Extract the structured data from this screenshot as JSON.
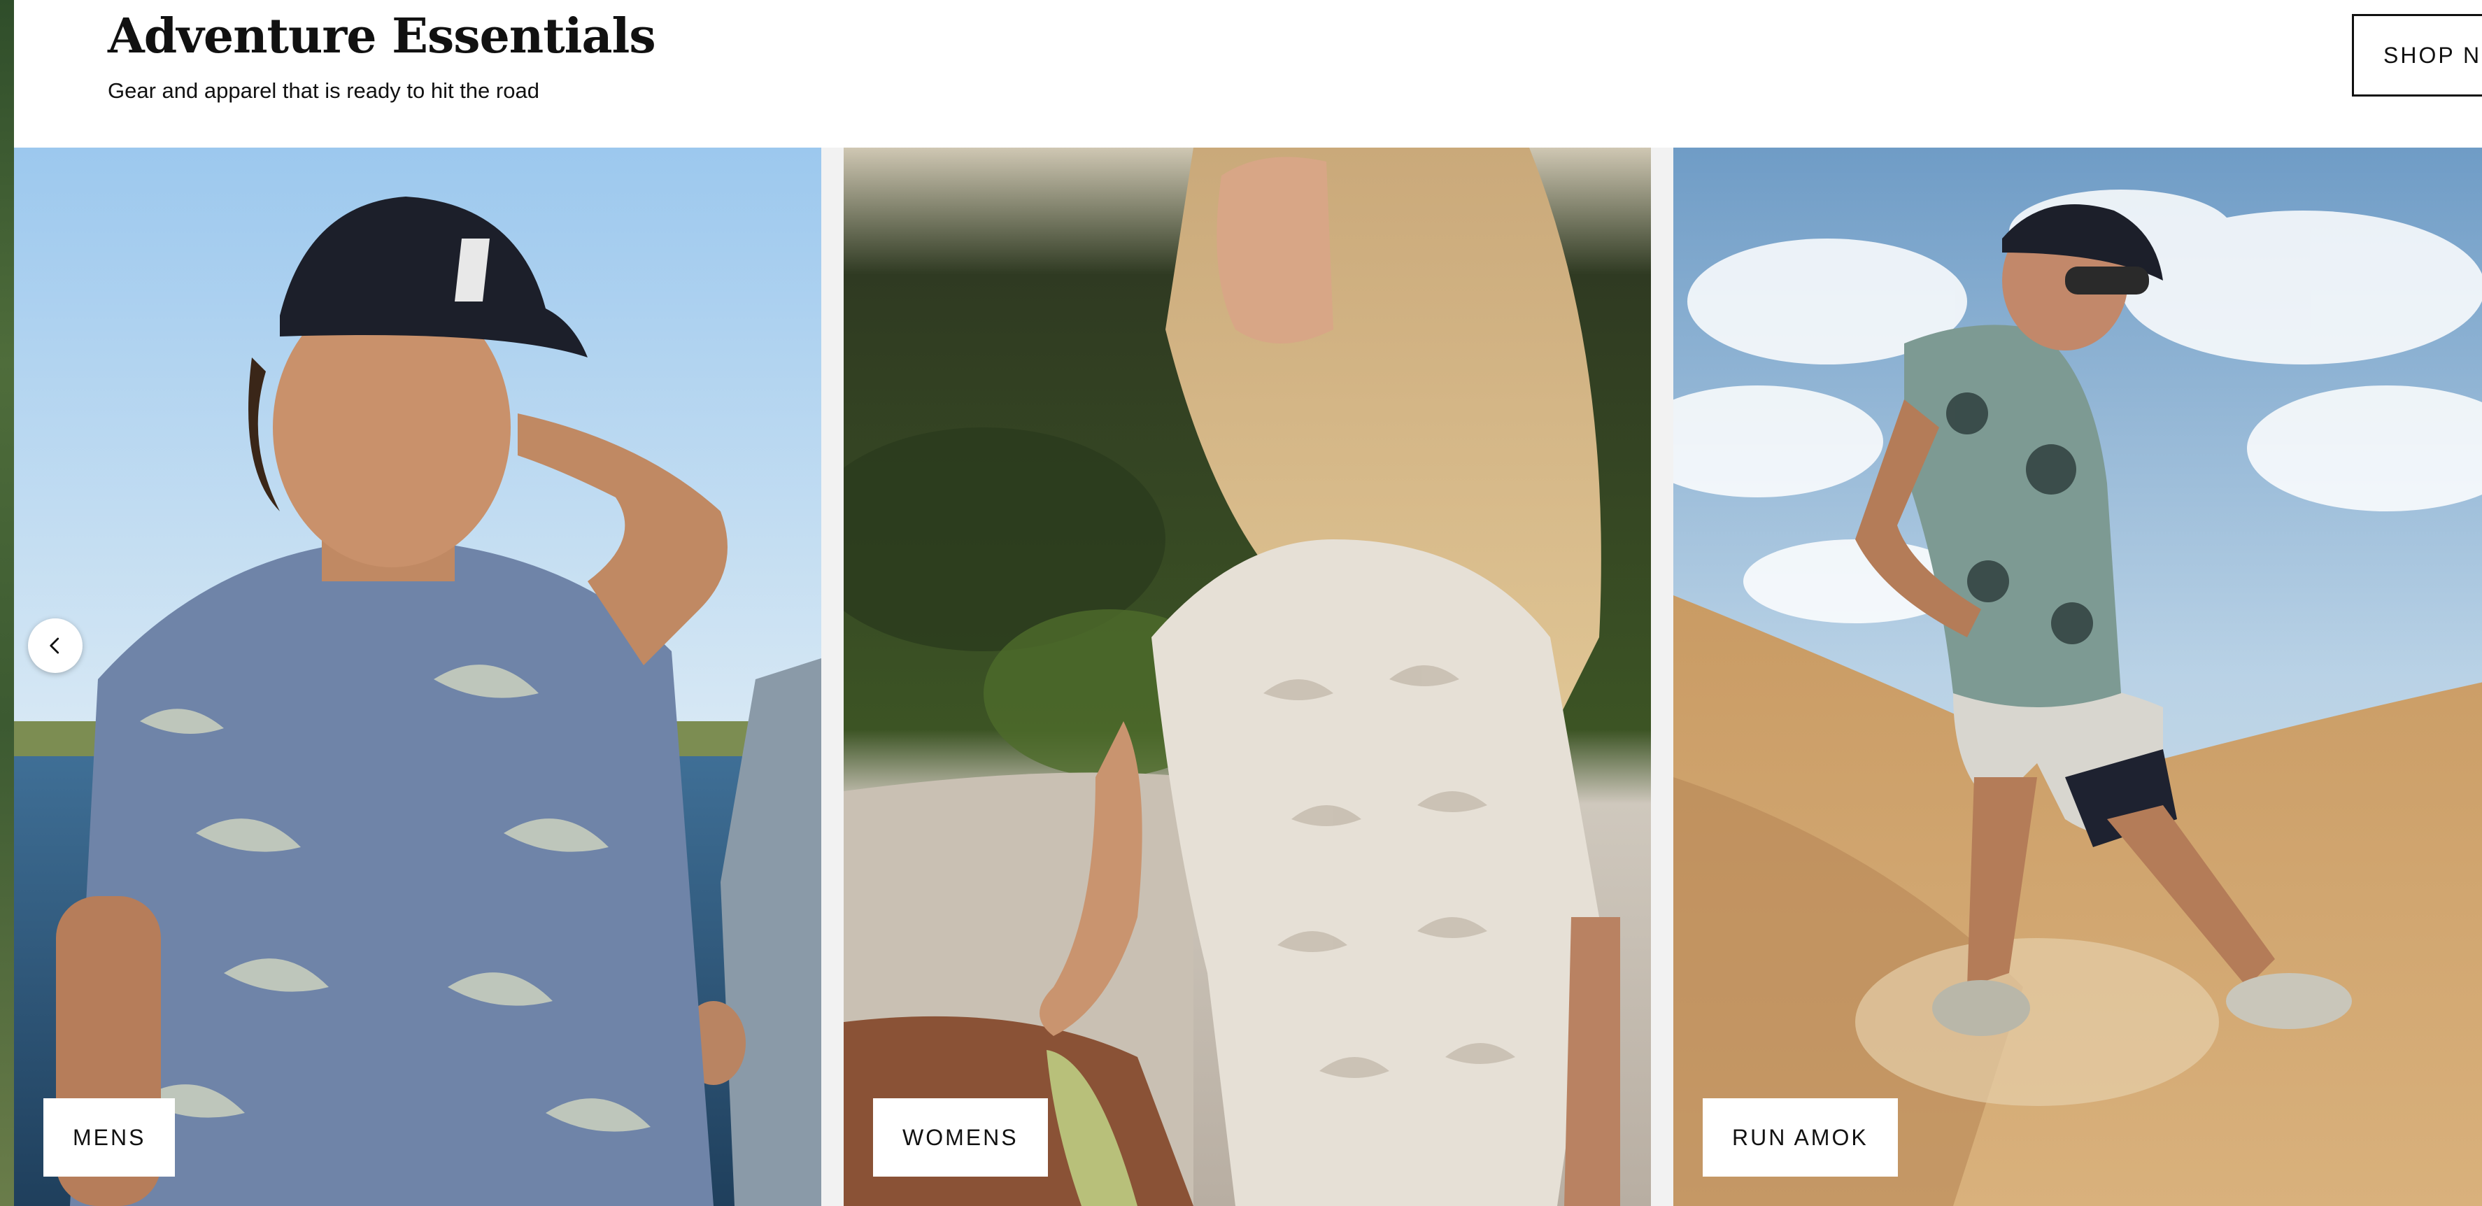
{
  "section": {
    "title": "Adventure Essentials",
    "subtitle": "Gear and apparel that is ready to hit the road",
    "shop_button_label": "SHOP NOW"
  },
  "carousel": {
    "prev_icon": "chevron-left-icon",
    "cards": [
      {
        "label": "MENS"
      },
      {
        "label": "WOMENS"
      },
      {
        "label": "RUN AMOK"
      }
    ]
  },
  "colors": {
    "text": "#111111",
    "background": "#ffffff"
  }
}
